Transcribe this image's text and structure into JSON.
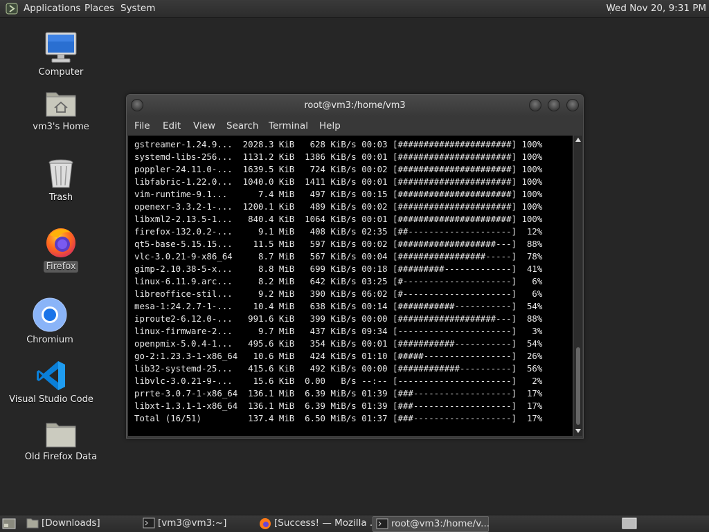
{
  "top_panel": {
    "menus": [
      "Applications",
      "Places",
      "System"
    ],
    "clock": "Wed Nov 20,  9:31 PM"
  },
  "desktop": {
    "icons": [
      {
        "label": "Computer",
        "icon": "computer-icon"
      },
      {
        "label": "vm3's Home",
        "icon": "home-folder-icon"
      },
      {
        "label": "Trash",
        "icon": "trash-icon"
      },
      {
        "label": "Firefox",
        "icon": "firefox-icon",
        "selected": true
      },
      {
        "label": "Chromium",
        "icon": "chromium-icon"
      },
      {
        "label": "Visual Studio Code",
        "icon": "vscode-icon"
      },
      {
        "label": "Old Firefox Data",
        "icon": "folder-icon"
      }
    ]
  },
  "terminal": {
    "title": "root@vm3:/home/vm3",
    "menu": [
      "File",
      "Edit",
      "View",
      "Search",
      "Terminal",
      "Help"
    ],
    "lines": [
      "gstreamer-1.24.9...  2028.3 KiB   628 KiB/s 00:03 [######################] 100%",
      "systemd-libs-256...  1131.2 KiB  1386 KiB/s 00:01 [######################] 100%",
      "poppler-24.11.0-...  1639.5 KiB   724 KiB/s 00:02 [######################] 100%",
      "libfabric-1.22.0...  1040.0 KiB  1411 KiB/s 00:01 [######################] 100%",
      "vim-runtime-9.1...      7.4 MiB   497 KiB/s 00:15 [######################] 100%",
      "openexr-3.3.2-1-...  1200.1 KiB   489 KiB/s 00:02 [######################] 100%",
      "libxml2-2.13.5-1...   840.4 KiB  1064 KiB/s 00:01 [######################] 100%",
      "firefox-132.0.2-...     9.1 MiB   408 KiB/s 02:35 [##--------------------]  12%",
      "qt5-base-5.15.15...    11.5 MiB   597 KiB/s 00:02 [###################---]  88%",
      "vlc-3.0.21-9-x86_64     8.7 MiB   567 KiB/s 00:04 [#################-----]  78%",
      "gimp-2.10.38-5-x...     8.8 MiB   699 KiB/s 00:18 [#########-------------]  41%",
      "linux-6.11.9.arc...     8.2 MiB   642 KiB/s 03:25 [#---------------------]   6%",
      "libreoffice-stil...     9.2 MiB   390 KiB/s 06:02 [#---------------------]   6%",
      "mesa-1:24.2.7-1-...    10.4 MiB   638 KiB/s 00:14 [###########-----------]  54%",
      "iproute2-6.12.0-...   991.6 KiB   399 KiB/s 00:00 [###################---]  88%",
      "linux-firmware-2...     9.7 MiB   437 KiB/s 09:34 [----------------------]   3%",
      "openpmix-5.0.4-1...   495.6 KiB   354 KiB/s 00:01 [###########-----------]  54%",
      "go-2:1.23.3-1-x86_64   10.6 MiB   424 KiB/s 01:10 [#####-----------------]  26%",
      "lib32-systemd-25...   415.6 KiB   492 KiB/s 00:00 [############----------]  56%",
      "libvlc-3.0.21-9-...    15.6 KiB  0.00   B/s --:-- [----------------------]   2%",
      "prrte-3.0.7-1-x86_64  136.1 MiB  6.39 MiB/s 01:39 [###-------------------]  17%",
      "libxt-1.3.1-1-x86_64  136.1 MiB  6.39 MiB/s 01:39 [###-------------------]  17%",
      "Total (16/51)         137.4 MiB  6.50 MiB/s 01:37 [###-------------------]  17%"
    ]
  },
  "taskbar": {
    "tasks": [
      {
        "label": "[Downloads]",
        "icon": "folder-icon"
      },
      {
        "label": "[vm3@vm3:~]",
        "icon": "terminal-icon"
      },
      {
        "label": "[Success! — Mozilla ...",
        "icon": "firefox-icon"
      },
      {
        "label": "root@vm3:/home/v...",
        "icon": "terminal-icon",
        "active": true
      }
    ]
  }
}
